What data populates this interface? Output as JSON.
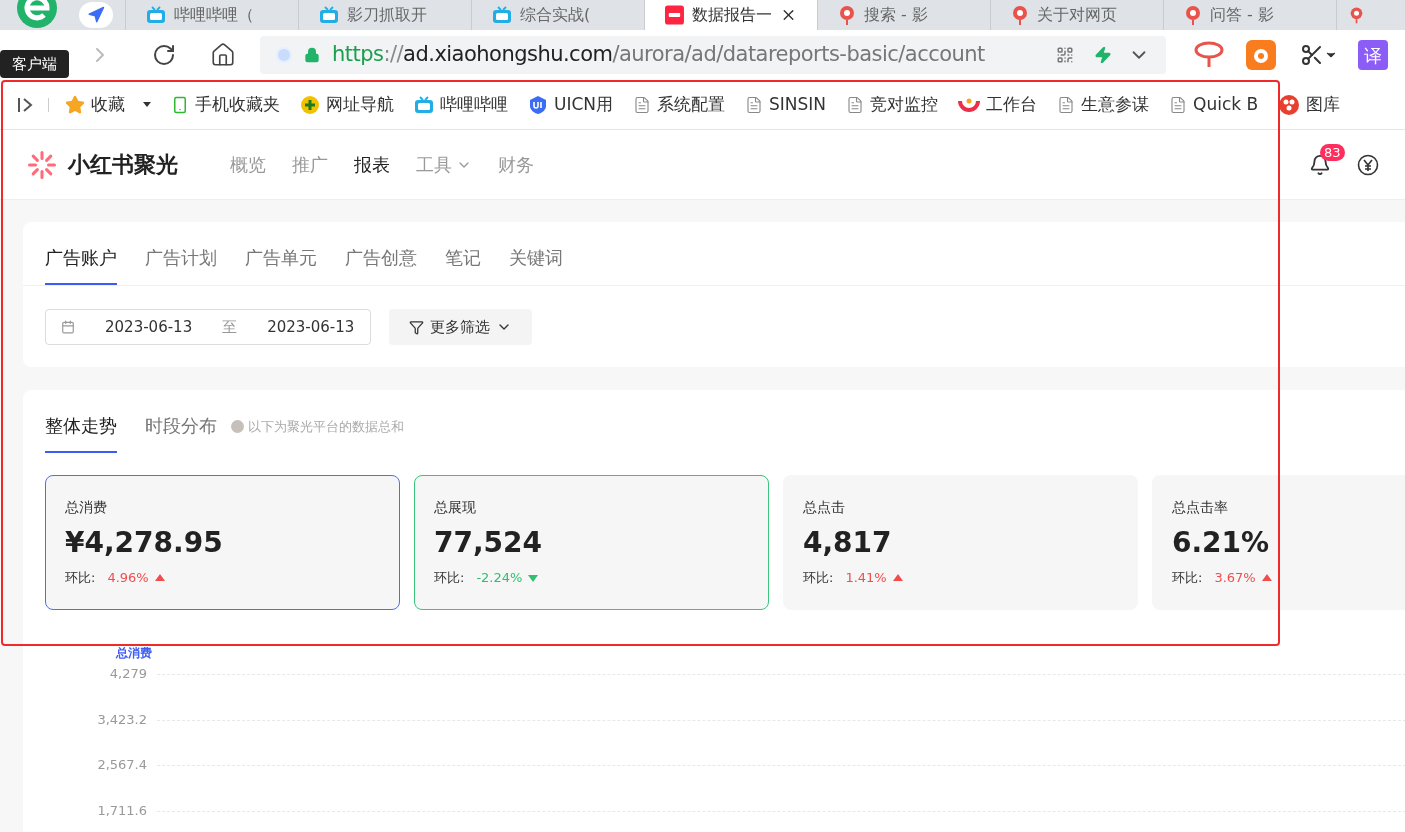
{
  "browser": {
    "tabs": [
      {
        "label": "哔哩哔哩（",
        "kind": "tv",
        "selected": false
      },
      {
        "label": "影刀抓取开",
        "kind": "tv",
        "selected": false
      },
      {
        "label": "综合实战(",
        "kind": "tv",
        "selected": false
      },
      {
        "label": "数据报告一",
        "kind": "note",
        "selected": true
      },
      {
        "label": "搜索 - 影",
        "kind": "pin",
        "selected": false
      },
      {
        "label": "关于对网页",
        "kind": "pin",
        "selected": false
      },
      {
        "label": "问答 - 影",
        "kind": "pin",
        "selected": false
      }
    ],
    "tooltip": "客户端",
    "url": {
      "scheme": "https",
      "sep": "://",
      "host": "ad.xiaohongshu.com",
      "path": "/aurora/ad/datareports-basic/account"
    },
    "translate_label": "译",
    "bookmarks": [
      {
        "label": "收藏",
        "kind": "star",
        "dropdown": true
      },
      {
        "label": "手机收藏夹",
        "kind": "phone",
        "dropdown": false
      },
      {
        "label": "网址导航",
        "kind": "plus",
        "dropdown": false
      },
      {
        "label": "哔哩哔哩",
        "kind": "tv",
        "dropdown": false
      },
      {
        "label": "UICN用",
        "kind": "shield",
        "dropdown": false
      },
      {
        "label": "系统配置",
        "kind": "page",
        "dropdown": false
      },
      {
        "label": "SINSIN",
        "kind": "page",
        "dropdown": false
      },
      {
        "label": "竞对监控",
        "kind": "page",
        "dropdown": false
      },
      {
        "label": "工作台",
        "kind": "ring",
        "dropdown": false
      },
      {
        "label": "生意参谋",
        "kind": "page",
        "dropdown": false
      },
      {
        "label": "Quick B",
        "kind": "page",
        "dropdown": false
      },
      {
        "label": "图库",
        "kind": "flower",
        "dropdown": false
      }
    ]
  },
  "app": {
    "brand": "小红书聚光",
    "nav": [
      {
        "label": "概览",
        "selected": false,
        "dropdown": false
      },
      {
        "label": "推广",
        "selected": false,
        "dropdown": false
      },
      {
        "label": "报表",
        "selected": true,
        "dropdown": false
      },
      {
        "label": "工具",
        "selected": false,
        "dropdown": true
      },
      {
        "label": "财务",
        "selected": false,
        "dropdown": false
      }
    ],
    "notification_count": "83",
    "report_tabs": [
      {
        "label": "广告账户",
        "selected": true
      },
      {
        "label": "广告计划",
        "selected": false
      },
      {
        "label": "广告单元",
        "selected": false
      },
      {
        "label": "广告创意",
        "selected": false
      },
      {
        "label": "笔记",
        "selected": false
      },
      {
        "label": "关键词",
        "selected": false
      }
    ],
    "date_range": {
      "start": "2023-06-13",
      "separator": "至",
      "end": "2023-06-13"
    },
    "filter_button": "更多筛选",
    "trend_tabs": [
      {
        "label": "整体走势",
        "selected": true
      },
      {
        "label": "时段分布",
        "selected": false
      }
    ],
    "trend_note": "以下为聚光平台的数据总和",
    "metrics": [
      {
        "title": "总消费",
        "value": "¥4,278.95",
        "change_label": "环比:",
        "change": "4.96%",
        "kind": "up",
        "selected": true,
        "color": "#4f6ef7"
      },
      {
        "title": "总展现",
        "value": "77,524",
        "change_label": "环比:",
        "change": "-2.24%",
        "kind": "down",
        "selected": true,
        "color": "#3cc47c"
      },
      {
        "title": "总点击",
        "value": "4,817",
        "change_label": "环比:",
        "change": "1.41%",
        "kind": "up",
        "selected": false
      },
      {
        "title": "总点击率",
        "value": "6.21%",
        "change_label": "环比:",
        "change": "3.67%",
        "kind": "up",
        "selected": false
      }
    ],
    "chart_data": {
      "type": "line",
      "series": [
        {
          "name": "总消费",
          "color": "#3d5cf5"
        }
      ],
      "ylim": [
        1711.6,
        4279
      ],
      "grid": true,
      "yticks": [
        {
          "value": 4279,
          "label": "4,279"
        },
        {
          "value": 3423.2,
          "label": "3,423.2"
        },
        {
          "value": 2567.4,
          "label": "2,567.4"
        },
        {
          "value": 1711.6,
          "label": "1,711.6"
        }
      ]
    }
  }
}
